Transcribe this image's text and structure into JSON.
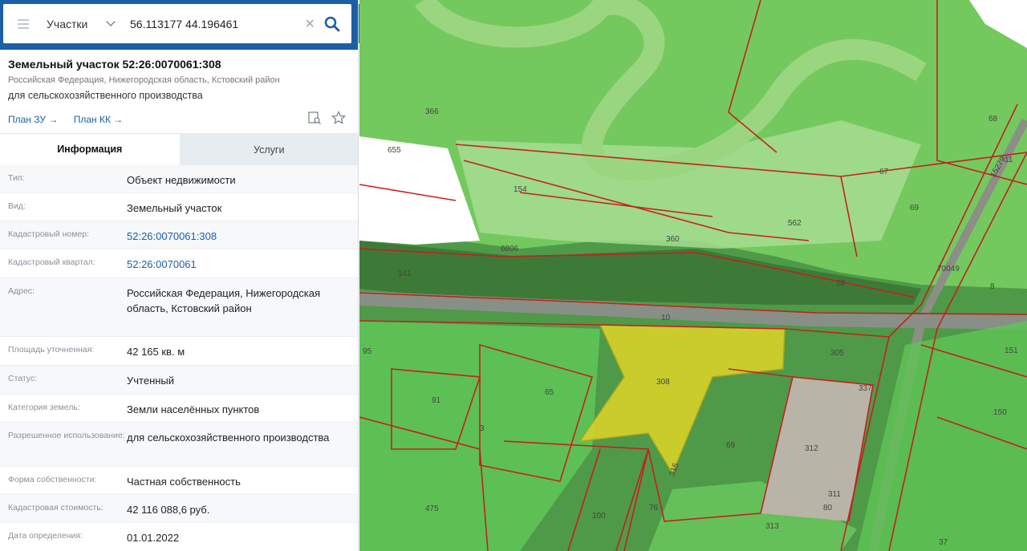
{
  "search": {
    "type": "Участки",
    "query": "56.113177 44.196461"
  },
  "parcel": {
    "title": "Земельный участок 52:26:0070061:308",
    "address": "Российская Федерация, Нижегородская область, Кстовский район",
    "use": "для сельскохозяйственного производства",
    "link_plan_zu": "План ЗУ →",
    "link_plan_kk": "План КК →"
  },
  "tabs": {
    "info": "Информация",
    "services": "Услуги"
  },
  "info": {
    "type_label": "Тип:",
    "type_value": "Объект недвижимости",
    "kind_label": "Вид:",
    "kind_value": "Земельный участок",
    "cad_num_label": "Кадастровый номер:",
    "cad_num_value": "52:26:0070061:308",
    "cad_quarter_label": "Кадастровый квартал:",
    "cad_quarter_value": "52:26:0070061",
    "address_label": "Адрес:",
    "address_value": "Российская Федерация, Нижегородская область, Кстовский район",
    "area_label": "Площадь уточненная:",
    "area_value": "42 165 кв. м",
    "status_label": "Статус:",
    "status_value": "Учтенный",
    "category_label": "Категория земель:",
    "category_value": "Земли населённых пунктов",
    "permitted_label": "Разрешенное использование:",
    "permitted_value": "для сельскохозяйственного производства",
    "ownership_label": "Форма собственности:",
    "ownership_value": "Частная собственность",
    "cad_cost_label": "Кадастровая стоимость:",
    "cad_cost_value": "42 116 088,6 руб.",
    "date_label": "Дата определения:",
    "date_value": "01.01.2022"
  },
  "map": {
    "labels": [
      "366",
      "655",
      "154",
      "6806",
      "360",
      "562",
      "67",
      "69",
      "68",
      "11",
      "15279",
      "70049",
      "8",
      "28",
      "141",
      "10",
      "95",
      "305",
      "151",
      "65",
      "308",
      "91",
      "3",
      "337",
      "69",
      "312",
      "150",
      "315",
      "311",
      "80",
      "76",
      "475",
      "100",
      "313",
      "37"
    ]
  },
  "colors": {
    "header_blue": "#1b5fa5",
    "link_blue": "#1b5fa5",
    "parcel_yellow": "#d8d22a",
    "zone_green": "#5fc455",
    "boundary_red": "#c42020"
  }
}
